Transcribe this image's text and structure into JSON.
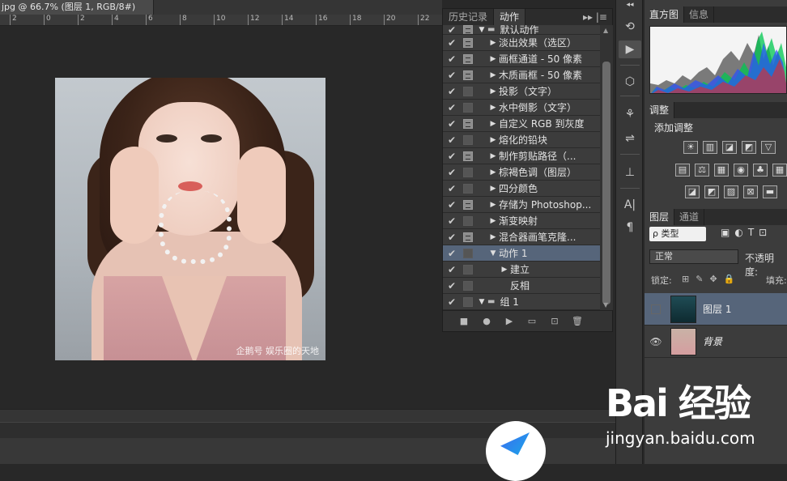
{
  "document": {
    "tab_title": "jpg @ 66.7% (图层 1, RGB/8#) *",
    "close_glyph": "×",
    "ruler_ticks": [
      "2",
      "0",
      "2",
      "4",
      "6",
      "8",
      "10",
      "12",
      "14",
      "16",
      "18",
      "20",
      "22"
    ],
    "watermark": "企鹅号 娱乐圈的天地"
  },
  "actions_panel": {
    "tabs": [
      {
        "label": "历史记录",
        "active": false
      },
      {
        "label": "动作",
        "active": true
      }
    ],
    "menu_glyph": "▸▸ |≡",
    "rows": [
      {
        "label": "默认动作",
        "checked": true,
        "dialog": true,
        "expand": "▼",
        "folder": true,
        "indent": 0,
        "selected": false,
        "partial": true
      },
      {
        "label": "淡出效果（选区）",
        "checked": true,
        "dialog": true,
        "expand": "▶",
        "folder": false,
        "indent": 1,
        "selected": false
      },
      {
        "label": "画框通道 - 50 像素",
        "checked": true,
        "dialog": true,
        "expand": "▶",
        "folder": false,
        "indent": 1,
        "selected": false
      },
      {
        "label": "木质画框 - 50 像素",
        "checked": true,
        "dialog": true,
        "expand": "▶",
        "folder": false,
        "indent": 1,
        "selected": false
      },
      {
        "label": "投影（文字）",
        "checked": true,
        "dialog": false,
        "expand": "▶",
        "folder": false,
        "indent": 1,
        "selected": false
      },
      {
        "label": "水中倒影（文字）",
        "checked": true,
        "dialog": false,
        "expand": "▶",
        "folder": false,
        "indent": 1,
        "selected": false
      },
      {
        "label": "自定义 RGB 到灰度",
        "checked": true,
        "dialog": true,
        "expand": "▶",
        "folder": false,
        "indent": 1,
        "selected": false
      },
      {
        "label": "熔化的铅块",
        "checked": true,
        "dialog": false,
        "expand": "▶",
        "folder": false,
        "indent": 1,
        "selected": false
      },
      {
        "label": "制作剪贴路径（...",
        "checked": true,
        "dialog": true,
        "expand": "▶",
        "folder": false,
        "indent": 1,
        "selected": false
      },
      {
        "label": "棕褐色调（图层）",
        "checked": true,
        "dialog": false,
        "expand": "▶",
        "folder": false,
        "indent": 1,
        "selected": false
      },
      {
        "label": "四分颜色",
        "checked": true,
        "dialog": false,
        "expand": "▶",
        "folder": false,
        "indent": 1,
        "selected": false
      },
      {
        "label": "存储为 Photoshop...",
        "checked": true,
        "dialog": true,
        "expand": "▶",
        "folder": false,
        "indent": 1,
        "selected": false
      },
      {
        "label": "渐变映射",
        "checked": true,
        "dialog": false,
        "expand": "▶",
        "folder": false,
        "indent": 1,
        "selected": false
      },
      {
        "label": "混合器画笔克隆...",
        "checked": true,
        "dialog": true,
        "expand": "▶",
        "folder": false,
        "indent": 1,
        "selected": false
      },
      {
        "label": "动作 1",
        "checked": true,
        "dialog": false,
        "expand": "▼",
        "folder": false,
        "indent": 1,
        "selected": true
      },
      {
        "label": "建立",
        "checked": true,
        "dialog": false,
        "expand": "▶",
        "folder": false,
        "indent": 2,
        "selected": false
      },
      {
        "label": "反相",
        "checked": true,
        "dialog": false,
        "expand": "",
        "folder": false,
        "indent": 2,
        "selected": false
      },
      {
        "label": "组 1",
        "checked": true,
        "dialog": false,
        "expand": "▼",
        "folder": true,
        "indent": 0,
        "selected": false
      }
    ],
    "footer_icons": [
      "stop-icon",
      "record-icon",
      "play-icon",
      "new-set-icon",
      "new-action-icon",
      "delete-icon"
    ],
    "footer_glyphs": [
      "■",
      "●",
      "▶",
      "▭",
      "⊡",
      "🗑"
    ]
  },
  "toolcol": {
    "collapse_glyph": "◂◂",
    "icons": [
      "history-brush-icon",
      "play-icon",
      "3d-icon",
      "brush-preset-icon",
      "sliders-icon",
      "clone-source-icon",
      "character-icon",
      "paragraph-icon"
    ],
    "glyphs": [
      "⟲",
      "▶",
      "⬡",
      "⚘",
      "⇌",
      "⊥",
      "A|",
      "¶"
    ]
  },
  "right_panels": {
    "histogram_tabs": [
      {
        "label": "直方图",
        "active": true
      },
      {
        "label": "信息",
        "active": false
      }
    ],
    "adjust_tabs": [
      {
        "label": "调整",
        "active": true
      }
    ],
    "adjust_title": "添加调整",
    "adjust_row1": [
      "☀",
      "▥",
      "◪",
      "◩",
      "▽"
    ],
    "adjust_row2": [
      "▤",
      "⚖",
      "▦",
      "◉",
      "♣",
      "▦"
    ],
    "adjust_row3": [
      "◪",
      "◩",
      "▨",
      "⊠",
      "▬"
    ],
    "layers_tabs": [
      {
        "label": "图层",
        "active": true
      },
      {
        "label": "通道",
        "active": false
      }
    ],
    "filter_label": "ρ 类型",
    "filter_icons": [
      "▣",
      "◐",
      "T",
      "⊡"
    ],
    "blend_mode": "正常",
    "opacity_label": "不透明度:",
    "lock_label": "锁定:",
    "lock_icons": [
      "⊞",
      "✎",
      "✥",
      "🔒"
    ],
    "fill_label": "填充:",
    "layers": [
      {
        "name": "图层 1",
        "visible": false,
        "selected": true
      },
      {
        "name": "背景",
        "visible": true,
        "selected": false
      }
    ]
  },
  "watermark_site": {
    "logo": "Bai 经验",
    "url": "jingyan.baidu.com"
  }
}
